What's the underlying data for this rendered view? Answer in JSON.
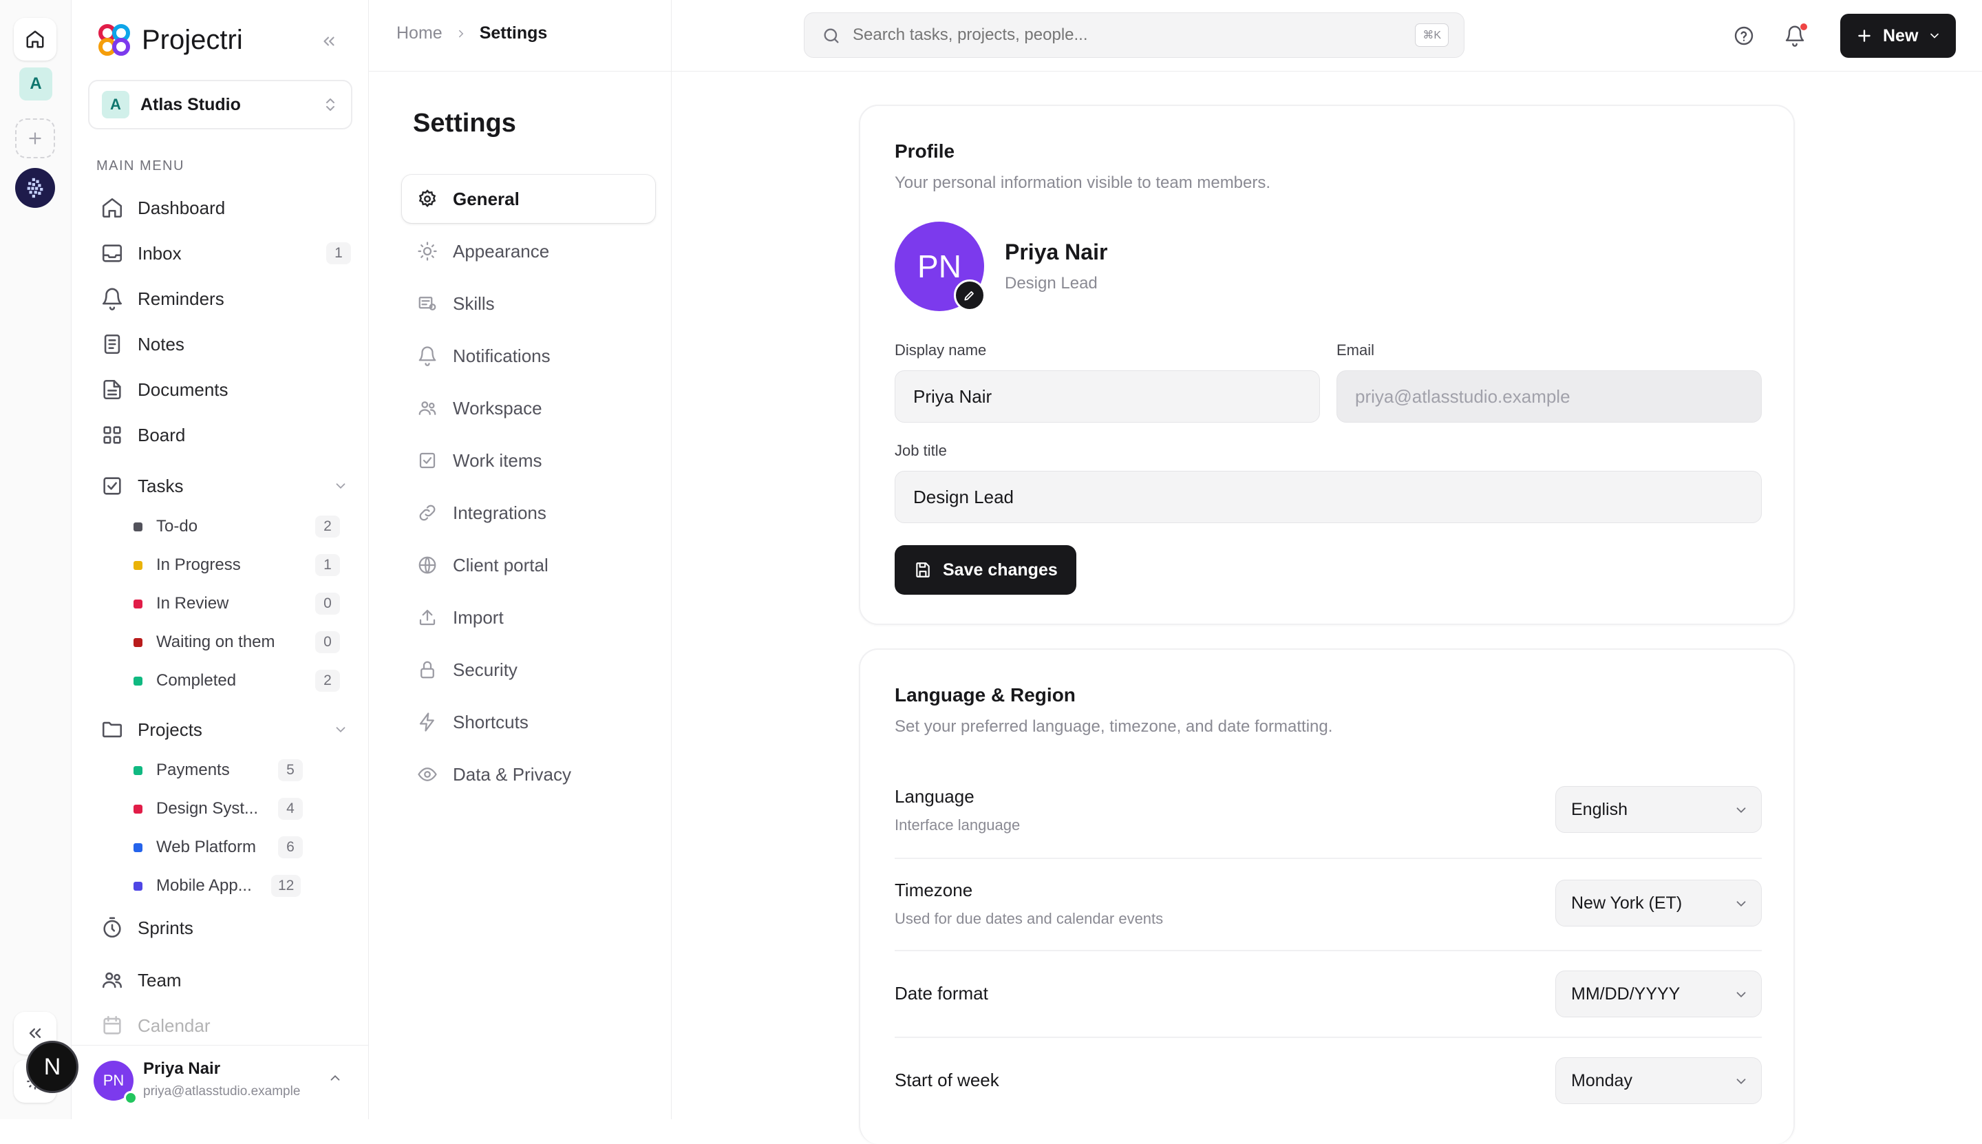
{
  "app": {
    "name": "Projectri"
  },
  "rail": {
    "workspace_initial": "A",
    "n_badge": "N"
  },
  "workspace": {
    "initial": "A",
    "name": "Atlas Studio"
  },
  "sidebar": {
    "section_label": "MAIN MENU",
    "items": [
      {
        "label": "Dashboard",
        "icon": "home-icon"
      },
      {
        "label": "Inbox",
        "icon": "inbox-icon",
        "count": "1"
      },
      {
        "label": "Reminders",
        "icon": "bell-icon"
      },
      {
        "label": "Notes",
        "icon": "note-icon"
      },
      {
        "label": "Documents",
        "icon": "document-icon"
      },
      {
        "label": "Board",
        "icon": "grid-icon"
      }
    ],
    "tasks": {
      "label": "Tasks",
      "items": [
        {
          "label": "To-do",
          "count": "2",
          "color": "#52525b"
        },
        {
          "label": "In Progress",
          "count": "1",
          "color": "#eab308"
        },
        {
          "label": "In Review",
          "count": "0",
          "color": "#e11d48"
        },
        {
          "label": "Waiting on them",
          "count": "0",
          "color": "#b91c1c"
        },
        {
          "label": "Completed",
          "count": "2",
          "color": "#10b981"
        }
      ]
    },
    "projects": {
      "label": "Projects",
      "items": [
        {
          "label": "Payments",
          "count": "5",
          "color": "#10b981"
        },
        {
          "label": "Design Syst...",
          "count": "4",
          "color": "#e11d48"
        },
        {
          "label": "Web Platform",
          "count": "6",
          "color": "#2563eb"
        },
        {
          "label": "Mobile App...",
          "count": "12",
          "color": "#4f46e5"
        }
      ]
    },
    "bottom_items": [
      {
        "label": "Sprints",
        "icon": "timer-icon"
      },
      {
        "label": "Team",
        "icon": "users-icon"
      },
      {
        "label": "Calendar",
        "icon": "calendar-icon"
      }
    ]
  },
  "user": {
    "initials": "PN",
    "name": "Priya Nair",
    "email": "priya@atlasstudio.example"
  },
  "breadcrumb": {
    "home": "Home",
    "current": "Settings"
  },
  "search": {
    "placeholder": "Search tasks, projects, people...",
    "shortcut": "⌘K"
  },
  "new_button": {
    "label": "New"
  },
  "settings_nav": {
    "title": "Settings",
    "items": [
      {
        "label": "General",
        "icon": "gear-icon",
        "active": true
      },
      {
        "label": "Appearance",
        "icon": "sun-icon"
      },
      {
        "label": "Skills",
        "icon": "skills-icon"
      },
      {
        "label": "Notifications",
        "icon": "bell-icon"
      },
      {
        "label": "Workspace",
        "icon": "users-icon"
      },
      {
        "label": "Work items",
        "icon": "checkbox-icon"
      },
      {
        "label": "Integrations",
        "icon": "link-icon"
      },
      {
        "label": "Client portal",
        "icon": "globe-icon"
      },
      {
        "label": "Import",
        "icon": "upload-icon"
      },
      {
        "label": "Security",
        "icon": "lock-icon"
      },
      {
        "label": "Shortcuts",
        "icon": "bolt-icon"
      },
      {
        "label": "Data & Privacy",
        "icon": "eye-icon"
      }
    ]
  },
  "profile": {
    "title": "Profile",
    "subtitle": "Your personal information visible to team members.",
    "initials": "PN",
    "name": "Priya Nair",
    "role": "Design Lead",
    "display_name_label": "Display name",
    "display_name_value": "Priya Nair",
    "email_label": "Email",
    "email_value": "priya@atlasstudio.example",
    "job_title_label": "Job title",
    "job_title_value": "Design Lead",
    "save_label": "Save changes"
  },
  "language_region": {
    "title": "Language & Region",
    "subtitle": "Set your preferred language, timezone, and date formatting.",
    "rows": [
      {
        "label": "Language",
        "sub": "Interface language",
        "value": "English"
      },
      {
        "label": "Timezone",
        "sub": "Used for due dates and calendar events",
        "value": "New York (ET)"
      },
      {
        "label": "Date format",
        "sub": "",
        "value": "MM/DD/YYYY"
      },
      {
        "label": "Start of week",
        "sub": "",
        "value": "Monday"
      }
    ]
  },
  "colors": {
    "accent": "#7c3aed",
    "primary_button": "#18181b",
    "notification_dot": "#ef4444",
    "online": "#22c55e"
  }
}
